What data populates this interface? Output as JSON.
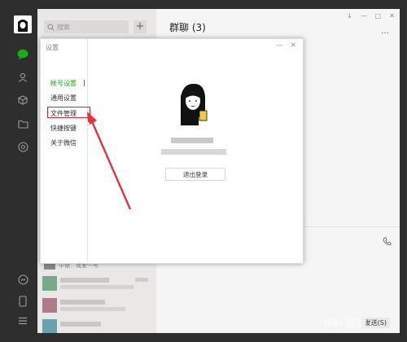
{
  "chat_list": {
    "search_placeholder": "搜索",
    "add_button": "+",
    "partial_item_text": "中银：我爱一号"
  },
  "chat": {
    "title": "群聊 (3)",
    "send_button": "发送(S)"
  },
  "settings": {
    "title": "设置",
    "menu": [
      {
        "label": "帐号设置",
        "active": true
      },
      {
        "label": "通用设置",
        "active": false
      },
      {
        "label": "文件管理",
        "active": false,
        "highlighted": true
      },
      {
        "label": "快捷按键",
        "active": false
      },
      {
        "label": "关于微信",
        "active": false
      }
    ],
    "logout_button": "退出登录"
  },
  "colors": {
    "accent_green": "#1aad19",
    "highlight_red": "#d3252b"
  },
  "watermark": "Bai 经验"
}
